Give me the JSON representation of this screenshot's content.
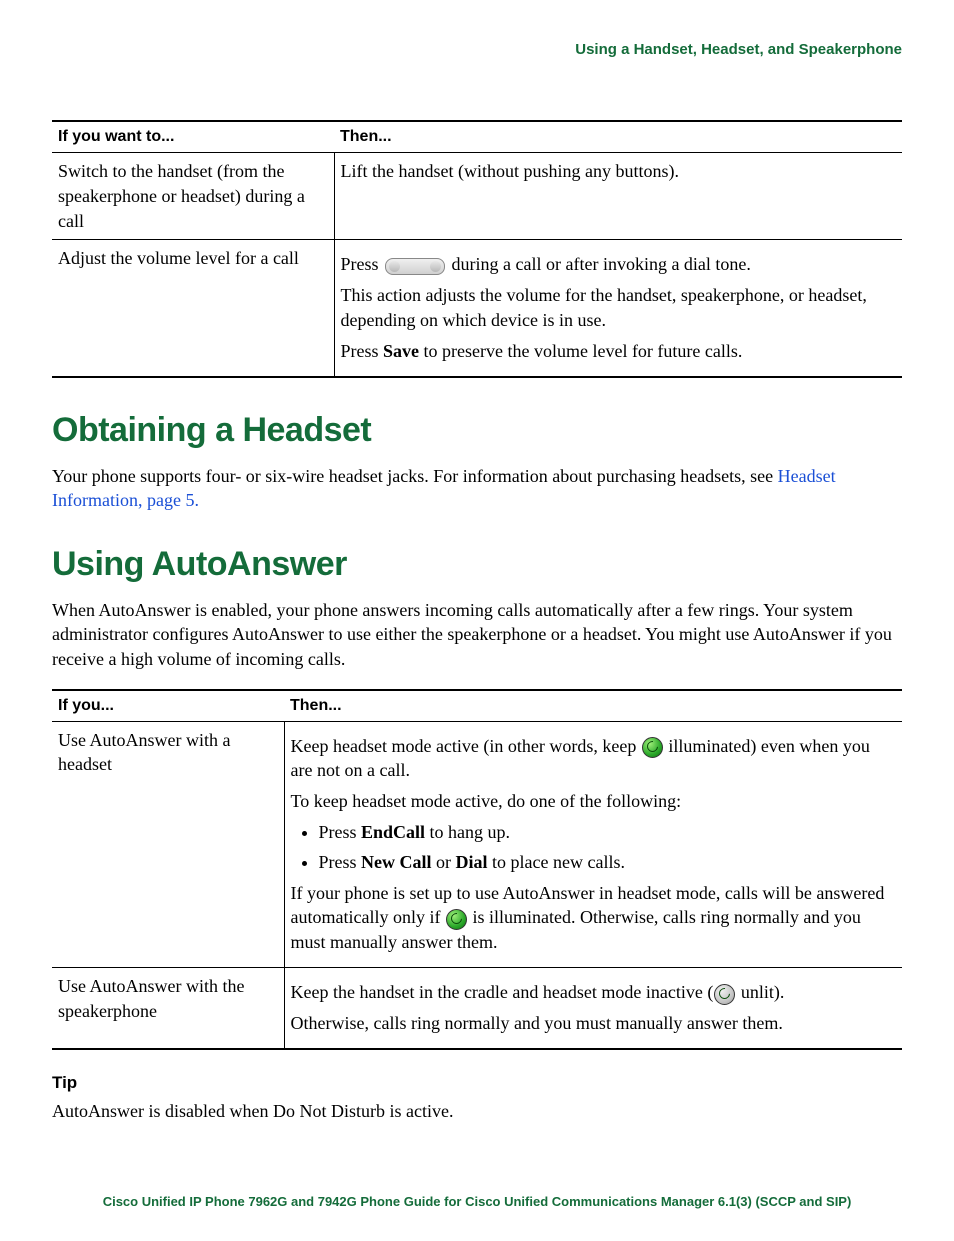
{
  "top_header": "Using a Handset, Headset, and Speakerphone",
  "table1": {
    "head": {
      "c1": "If you want to...",
      "c2": "Then..."
    },
    "r1": {
      "c1": "Switch to the handset (from the speakerphone or headset) during a call",
      "c2": "Lift the handset (without pushing any buttons)."
    },
    "r2": {
      "c1": "Adjust the volume level for a call",
      "p1a": "Press ",
      "p1b": " during a call or after invoking a dial tone.",
      "p2": "This action adjusts the volume for the handset, speakerphone, or headset, depending on which device is in use.",
      "p3a": "Press ",
      "p3b": "Save",
      "p3c": " to preserve the volume level for future calls."
    }
  },
  "h1a": "Obtaining a Headset",
  "obtain_p1": "Your phone supports four- or six-wire headset jacks. For information about purchasing headsets, see ",
  "obtain_link": "Headset Information, page 5.",
  "h1b": "Using AutoAnswer",
  "auto_p1": "When AutoAnswer is enabled, your phone answers incoming calls automatically after a few rings. Your system administrator configures AutoAnswer to use either the speakerphone or a headset. You might use AutoAnswer if you receive a high volume of incoming calls.",
  "table2": {
    "head": {
      "c1": "If you...",
      "c2": "Then..."
    },
    "r1": {
      "c1": "Use AutoAnswer with a headset",
      "p1a": "Keep headset mode active (in other words, keep ",
      "p1b": " illuminated) even when you are not on a call.",
      "p2": "To keep headset mode active, do one of the following:",
      "li1a": "Press ",
      "li1b": "EndCall",
      "li1c": " to hang up.",
      "li2a": "Press ",
      "li2b": "New Call",
      "li2c": " or ",
      "li2d": "Dial",
      "li2e": " to place new calls.",
      "p3a": "If your phone is set up to use AutoAnswer in headset mode, calls will be answered automatically only if ",
      "p3b": " is illuminated. Otherwise, calls ring normally and you must manually answer them."
    },
    "r2": {
      "c1": "Use AutoAnswer with the speakerphone",
      "p1a": "Keep the handset in the cradle and headset mode inactive (",
      "p1b": " unlit).",
      "p2": "Otherwise, calls ring normally and you must manually answer them."
    }
  },
  "tip_label": "Tip",
  "tip_text": "AutoAnswer is disabled when Do Not Disturb is active.",
  "footer": "Cisco Unified IP Phone 7962G and 7942G Phone Guide for Cisco Unified Communications Manager 6.1(3) (SCCP and SIP)"
}
